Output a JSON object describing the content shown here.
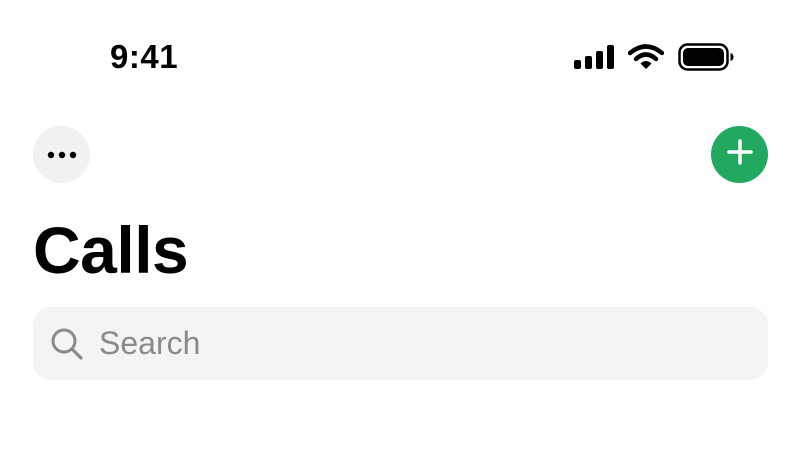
{
  "status_bar": {
    "time": "9:41",
    "icons": [
      "cellular-signal-icon",
      "wifi-icon",
      "battery-icon"
    ]
  },
  "header": {
    "more_button_icon": "ellipsis-icon",
    "add_button_icon": "plus-icon",
    "title": "Calls"
  },
  "search": {
    "placeholder": "Search",
    "value": "",
    "icon": "search-icon"
  },
  "colors": {
    "accent_green": "#22a861",
    "search_background": "#f4f4f2",
    "more_button_background": "#f1f1f1",
    "placeholder_text": "#8a8a8e"
  }
}
